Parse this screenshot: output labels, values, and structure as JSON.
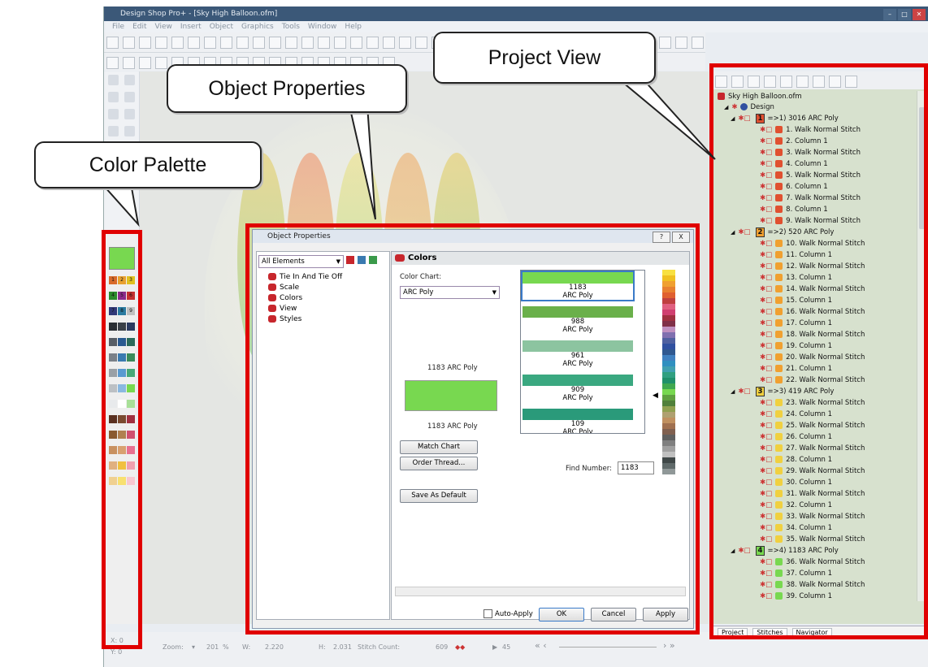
{
  "window": {
    "title": "Design Shop Pro+ - [Sky High Balloon.ofm]",
    "menu": [
      "File",
      "Edit",
      "View",
      "Insert",
      "Object",
      "Graphics",
      "Tools",
      "Window",
      "Help"
    ]
  },
  "callouts": {
    "color_palette": "Color Palette",
    "object_properties": "Object Properties",
    "project_view": "Project View"
  },
  "palette": {
    "selected_color": "#78d850",
    "swatches": [
      "#d86a2a",
      "#e8a030",
      "#e0c020",
      "#2a8a2a",
      "#8a2a8a",
      "#c43030",
      "#303878",
      "#2a7aa0",
      "#c0c0c0",
      "#2a2e34",
      "#3a4048",
      "#2a3a60",
      "#585e66",
      "#2a5a90",
      "#2a6a5a",
      "#7a8088",
      "#3a7ab0",
      "#3a8a5a",
      "#9aa0a6",
      "#5a9ad0",
      "#48a878",
      "#bcc0c4",
      "#8ab8e0",
      "#78d850",
      "#e8eaec",
      "#ffffff",
      "#a8e098",
      "#5a3020",
      "#7a4a30",
      "#a03040",
      "#8a5a30",
      "#b08050",
      "#d05070",
      "#c89060",
      "#d8a070",
      "#e87090",
      "#e0b080",
      "#f0c040",
      "#f0a0b0",
      "#f0d090",
      "#f8e070",
      "#f8c8d0"
    ]
  },
  "project": {
    "root": "Sky High Balloon.ofm",
    "design_label": "Design",
    "groups": [
      {
        "num": "1",
        "label": "=>1) 3016 ARC Poly",
        "color": "#e05030"
      },
      {
        "num": "2",
        "label": "=>2) 520 ARC Poly",
        "color": "#f0a030"
      },
      {
        "num": "3",
        "label": "=>3) 419 ARC Poly",
        "color": "#f0d040"
      },
      {
        "num": "4",
        "label": "=>4) 1183 ARC Poly",
        "color": "#78d850"
      }
    ],
    "items": [
      {
        "label": "1. Walk Normal Stitch",
        "color": "#e05030"
      },
      {
        "label": "2. Column 1",
        "color": "#e05030"
      },
      {
        "label": "3. Walk Normal Stitch",
        "color": "#e05030"
      },
      {
        "label": "4. Column 1",
        "color": "#e05030"
      },
      {
        "label": "5. Walk Normal Stitch",
        "color": "#e05030"
      },
      {
        "label": "6. Column 1",
        "color": "#e05030"
      },
      {
        "label": "7. Walk Normal Stitch",
        "color": "#e05030"
      },
      {
        "label": "8. Column 1",
        "color": "#e05030"
      },
      {
        "label": "9. Walk Normal Stitch",
        "color": "#e05030"
      },
      {
        "label": "10. Walk Normal Stitch",
        "color": "#f0a030"
      },
      {
        "label": "11. Column 1",
        "color": "#f0a030"
      },
      {
        "label": "12. Walk Normal Stitch",
        "color": "#f0a030"
      },
      {
        "label": "13. Column 1",
        "color": "#f0a030"
      },
      {
        "label": "14. Walk Normal Stitch",
        "color": "#f0a030"
      },
      {
        "label": "15. Column 1",
        "color": "#f0a030"
      },
      {
        "label": "16. Walk Normal Stitch",
        "color": "#f0a030"
      },
      {
        "label": "17. Column 1",
        "color": "#f0a030"
      },
      {
        "label": "18. Walk Normal Stitch",
        "color": "#f0a030"
      },
      {
        "label": "19. Column 1",
        "color": "#f0a030"
      },
      {
        "label": "20. Walk Normal Stitch",
        "color": "#f0a030"
      },
      {
        "label": "21. Column 1",
        "color": "#f0a030"
      },
      {
        "label": "22. Walk Normal Stitch",
        "color": "#f0a030"
      },
      {
        "label": "23. Walk Normal Stitch",
        "color": "#f0d040"
      },
      {
        "label": "24. Column 1",
        "color": "#f0d040"
      },
      {
        "label": "25. Walk Normal Stitch",
        "color": "#f0d040"
      },
      {
        "label": "26. Column 1",
        "color": "#f0d040"
      },
      {
        "label": "27. Walk Normal Stitch",
        "color": "#f0d040"
      },
      {
        "label": "28. Column 1",
        "color": "#f0d040"
      },
      {
        "label": "29. Walk Normal Stitch",
        "color": "#f0d040"
      },
      {
        "label": "30. Column 1",
        "color": "#f0d040"
      },
      {
        "label": "31. Walk Normal Stitch",
        "color": "#f0d040"
      },
      {
        "label": "32. Column 1",
        "color": "#f0d040"
      },
      {
        "label": "33. Walk Normal Stitch",
        "color": "#f0d040"
      },
      {
        "label": "34. Column 1",
        "color": "#f0d040"
      },
      {
        "label": "35. Walk Normal Stitch",
        "color": "#f0d040"
      },
      {
        "label": "36. Walk Normal Stitch",
        "color": "#78d850"
      },
      {
        "label": "37. Column 1",
        "color": "#78d850"
      },
      {
        "label": "38. Walk Normal Stitch",
        "color": "#78d850"
      },
      {
        "label": "39. Column 1",
        "color": "#78d850"
      }
    ],
    "tabs": [
      "Project",
      "Stitches",
      "Navigator"
    ]
  },
  "dialog": {
    "title": "Object Properties",
    "help": "?",
    "close": "X",
    "filter": "All Elements",
    "nav": [
      "Tie In And Tie Off",
      "Scale",
      "Colors",
      "View",
      "Styles"
    ],
    "section_title": "Colors",
    "color_chart_label": "Color Chart:",
    "color_chart_value": "ARC Poly",
    "preview_top": "1183 ARC Poly",
    "preview_bottom": "1183 ARC Poly",
    "preview_color": "#78d850",
    "chart_items": [
      {
        "number": "1183",
        "chart": "ARC Poly",
        "color": "#78d850"
      },
      {
        "number": "988",
        "chart": "ARC Poly",
        "color": "#6ab04a"
      },
      {
        "number": "961",
        "chart": "ARC Poly",
        "color": "#8cc4a0"
      },
      {
        "number": "909",
        "chart": "ARC Poly",
        "color": "#3aa880"
      },
      {
        "number": "109",
        "chart": "ARC Poly",
        "color": "#2a9a7a"
      }
    ],
    "strip_colors": [
      "#f8e040",
      "#f0c020",
      "#f0a030",
      "#e88030",
      "#e06030",
      "#c04040",
      "#e06080",
      "#d04070",
      "#a03040",
      "#803048",
      "#c090c0",
      "#8070b0",
      "#5060a0",
      "#3050a0",
      "#305890",
      "#4080c0",
      "#3090c0",
      "#40a0b0",
      "#30a080",
      "#20906a",
      "#40a850",
      "#78d850",
      "#60a040",
      "#50803a",
      "#90a050",
      "#b0a070",
      "#c09060",
      "#a07050",
      "#806050",
      "#606060",
      "#808080",
      "#a0a0a0",
      "#c0c0c0",
      "#404848",
      "#606a6a",
      "#909898"
    ],
    "match_chart": "Match Chart",
    "order_thread": "Order Thread...",
    "save_default": "Save As Default",
    "find_number_label": "Find Number:",
    "find_number_value": "1183",
    "auto_apply": "Auto-Apply",
    "ok": "OK",
    "cancel": "Cancel",
    "apply": "Apply"
  },
  "status": {
    "x": "X: 0",
    "y": "Y: 0",
    "zoom_label": "Zoom:",
    "zoom_value": "201",
    "zoom_unit": "%",
    "w_label": "W:",
    "w_value": "2.220",
    "h_label": "H:",
    "h_value": "2.031",
    "stitch_count_label": "Stitch Count:",
    "stitch_count_value": "609",
    "play_value": "45"
  }
}
